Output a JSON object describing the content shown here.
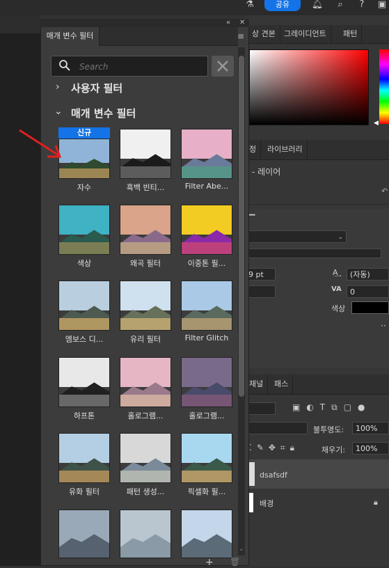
{
  "topbar": {
    "share_label": "공유"
  },
  "panel": {
    "tab_label": "매개 변수 필터",
    "search_placeholder": "Search",
    "section_user": "사용자 필터",
    "section_param": "매개 변수 필터",
    "new_badge": "신규"
  },
  "filters": [
    {
      "label": "자수"
    },
    {
      "label": "흑백 빈티..."
    },
    {
      "label": "Filter Abe..."
    },
    {
      "label": "색상"
    },
    {
      "label": "왜곡 필터"
    },
    {
      "label": "이중톤 필..."
    },
    {
      "label": "엠보스 디..."
    },
    {
      "label": "유리 필터"
    },
    {
      "label": "Filter Glitch"
    },
    {
      "label": "하프톤"
    },
    {
      "label": "홀로그램..."
    },
    {
      "label": "홀로그램..."
    },
    {
      "label": "유화 필터"
    },
    {
      "label": "패턴 생성..."
    },
    {
      "label": "픽셀화 필..."
    }
  ],
  "right": {
    "color_tabs": [
      "상 견본",
      "그레이디언트",
      "패턴"
    ],
    "layer_tabs": [
      "정",
      "라이브러리"
    ],
    "props_title": "- 레이어",
    "font_size_value": "9 pt",
    "leading_value": "(자동)",
    "tracking_value": "0",
    "color_label": "색상",
    "layers_tabs": [
      "채널",
      "패스"
    ],
    "opacity_label": "불투명도:",
    "opacity_value": "100%",
    "fill_label": "채우기:",
    "fill_value": "100%",
    "layers": [
      {
        "name": "dsafsdf"
      },
      {
        "name": "배경"
      }
    ]
  }
}
